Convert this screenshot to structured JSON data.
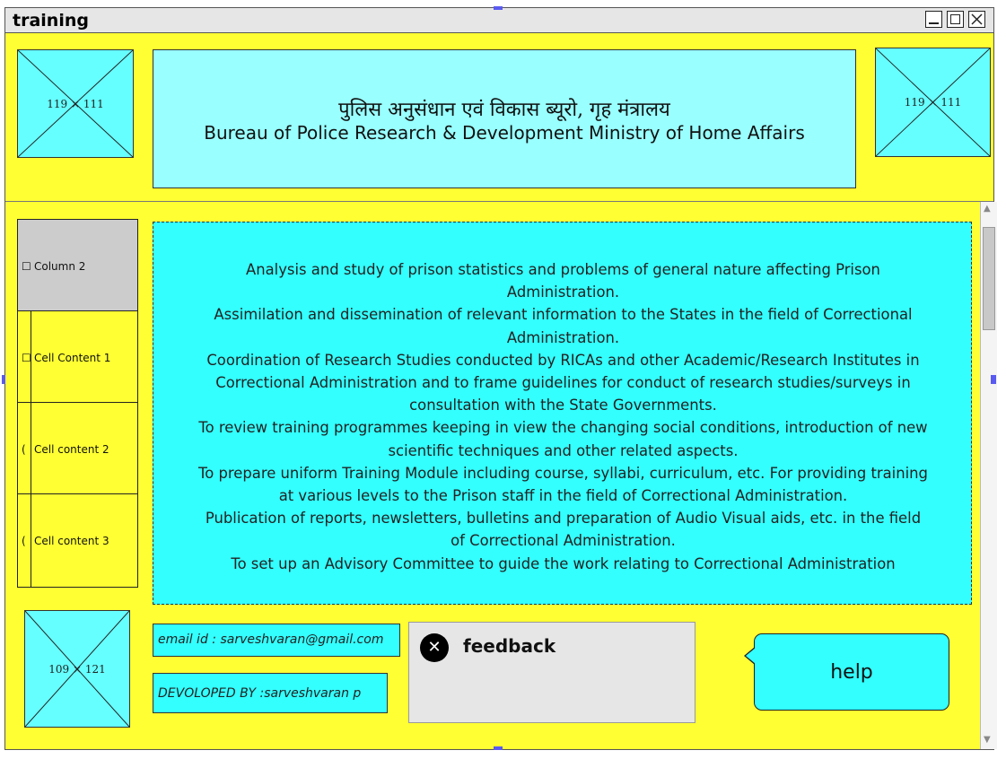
{
  "window": {
    "title": "training"
  },
  "header": {
    "hindi": "पुलिस अनुसंधान एवं विकास ब्यूरो, गृह मंत्रालय",
    "english": "Bureau of Police Research & Development Ministry of Home Affairs",
    "left_image_label": "119 × 111",
    "right_image_label": "119 × 111"
  },
  "sidebar": {
    "rows": [
      {
        "label": "Column 2"
      },
      {
        "label": "Cell Content 1"
      },
      {
        "label": "Cell content 2"
      },
      {
        "label": "Cell content 3"
      }
    ]
  },
  "content": {
    "lines": [
      "Analysis and study of prison statistics and problems of general nature affecting Prison Administration.",
      "Assimilation and dissemination of relevant information to the States in the field of Correctional Administration.",
      "Coordination of Research Studies conducted by RICAs and other Academic/Research Institutes in Correctional Administration and to frame guidelines for conduct of research studies/surveys in consultation with the State Governments.",
      "To review training programmes keeping in view the changing social conditions, introduction of new scientific techniques and other related aspects.",
      "To prepare uniform Training Module including course, syllabi, curriculum, etc. For providing training at various levels to the Prison staff in the field of Correctional Administration.",
      "Publication of reports, newsletters, bulletins and preparation of Audio Visual aids, etc. in the field of Correctional Administration.",
      "To set up an Advisory Committee to guide the work relating to Correctional Administration"
    ]
  },
  "footer": {
    "image_label": "109 × 121",
    "email": "email id : sarveshvaran@gmail.com",
    "developed_by": "DEVOLOPED BY :sarveshvaran p",
    "feedback_label": "feedback",
    "help_label": "help"
  },
  "colors": {
    "background": "#ffff33",
    "panel": "#33ffff",
    "header_panel": "#99ffff"
  }
}
